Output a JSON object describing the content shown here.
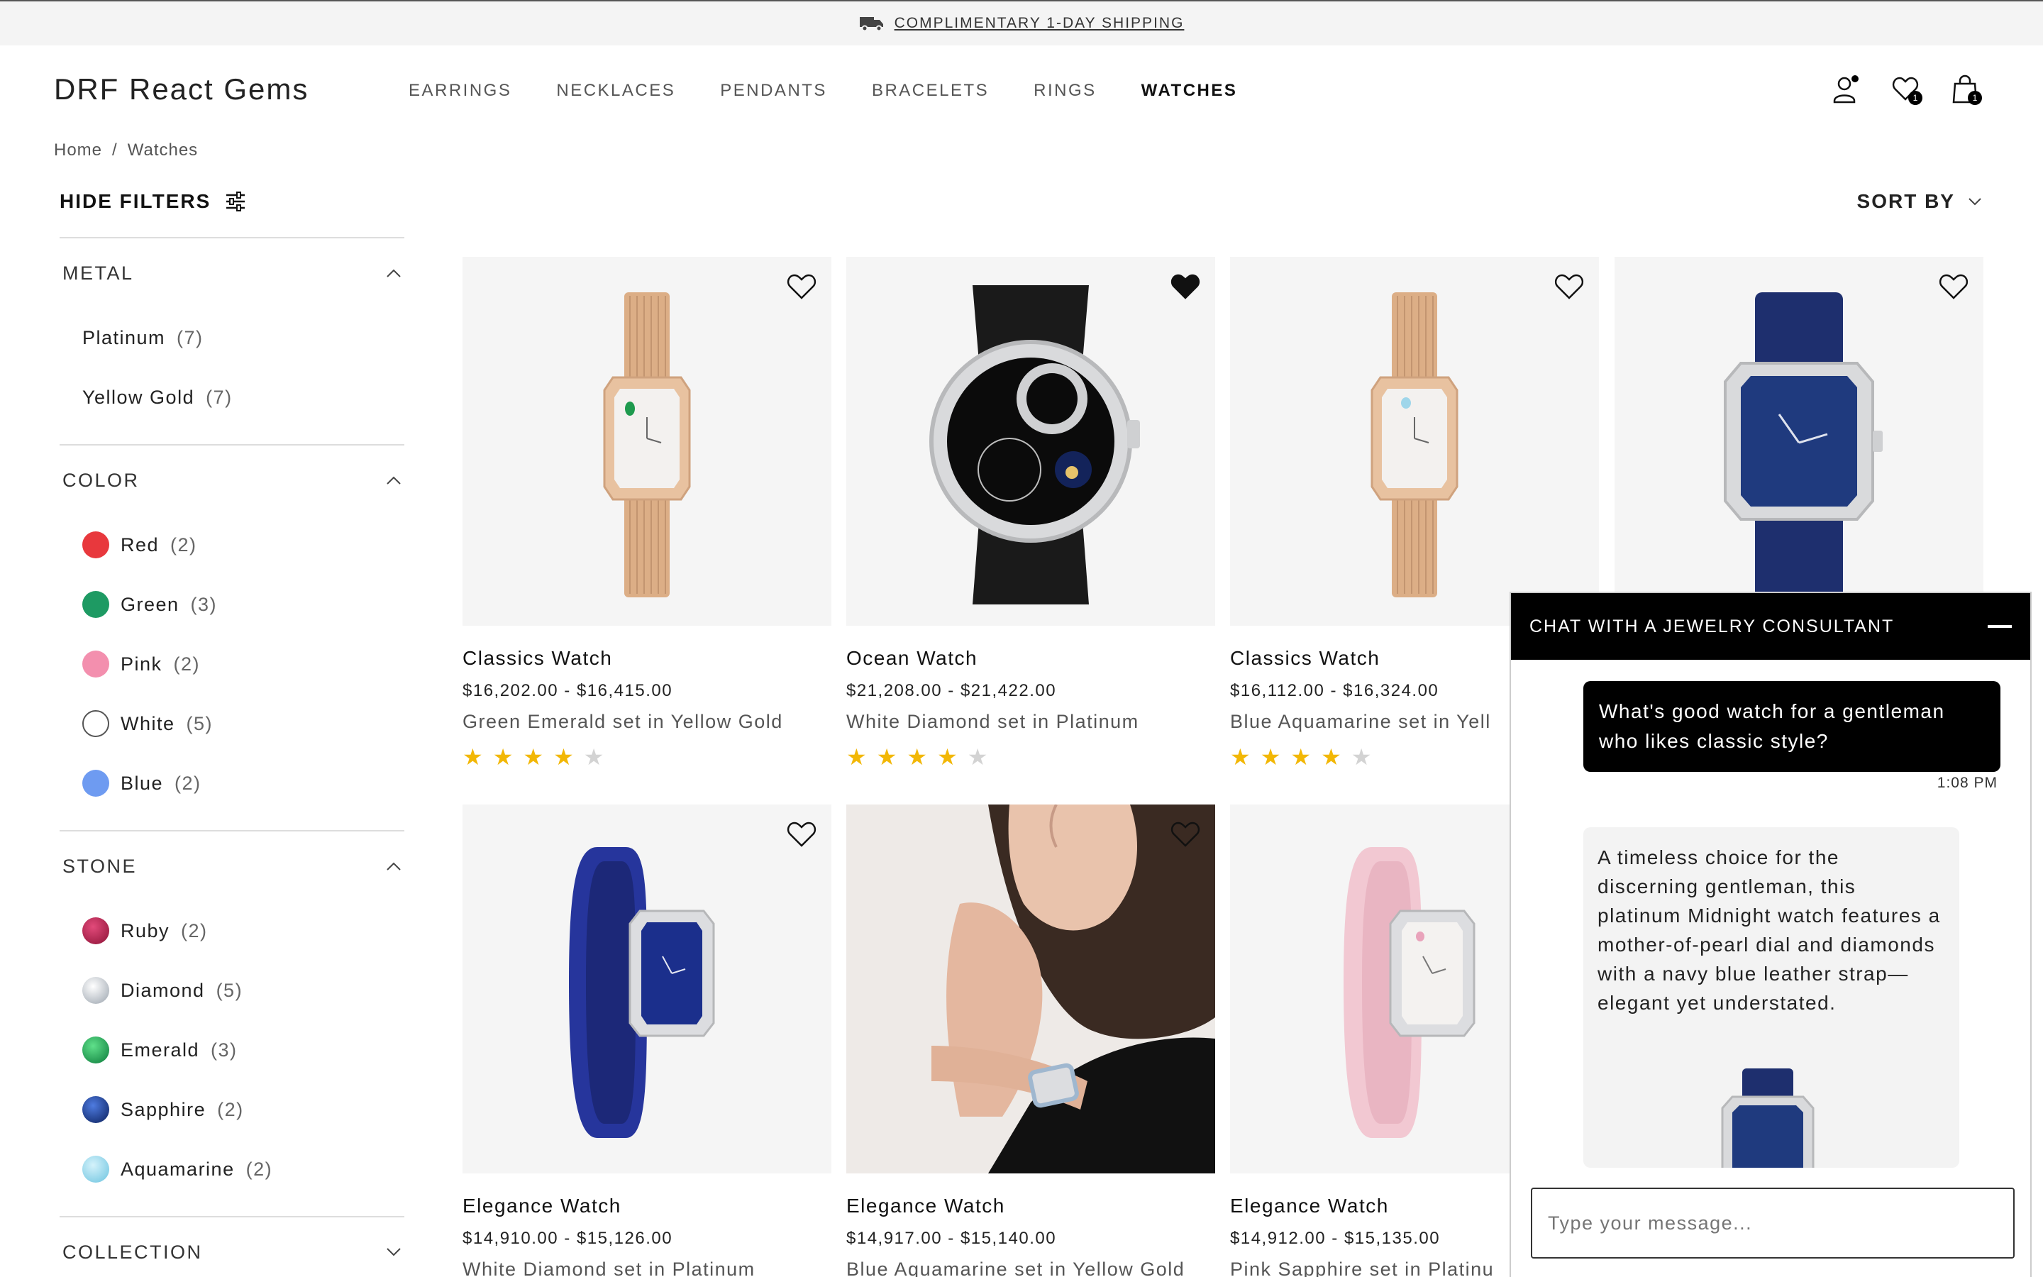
{
  "banner": {
    "text": "COMPLIMENTARY 1-DAY SHIPPING",
    "icon": "truck-icon"
  },
  "header": {
    "logo": "DRF React Gems",
    "nav": [
      "EARRINGS",
      "NECKLACES",
      "PENDANTS",
      "BRACELETS",
      "RINGS",
      "WATCHES"
    ],
    "active_nav": "WATCHES",
    "icons": {
      "account": "user-icon",
      "wishlist": "heart-icon",
      "bag": "shopping-bag-icon"
    },
    "wishlist_count": "1",
    "bag_count": "1"
  },
  "breadcrumb": {
    "home": "Home",
    "sep": "/",
    "current": "Watches"
  },
  "filters": {
    "hide_label": "HIDE FILTERS",
    "sections": [
      {
        "title": "METAL",
        "options": [
          {
            "label": "Platinum",
            "count": "(7)"
          },
          {
            "label": "Yellow Gold",
            "count": "(7)"
          }
        ]
      },
      {
        "title": "COLOR",
        "options": [
          {
            "label": "Red",
            "count": "(2)",
            "color": "#e8383d"
          },
          {
            "label": "Green",
            "count": "(3)",
            "color": "#1e9a63"
          },
          {
            "label": "Pink",
            "count": "(2)",
            "color": "#f38fae"
          },
          {
            "label": "White",
            "count": "(5)",
            "color": "#ffffff"
          },
          {
            "label": "Blue",
            "count": "(2)",
            "color": "#6e9bf1"
          }
        ]
      },
      {
        "title": "STONE",
        "options": [
          {
            "label": "Ruby",
            "count": "(2)",
            "color": "#b0244d"
          },
          {
            "label": "Diamond",
            "count": "(5)",
            "color": "#d8dde3"
          },
          {
            "label": "Emerald",
            "count": "(3)",
            "color": "#1fa453"
          },
          {
            "label": "Sapphire",
            "count": "(2)",
            "color": "#123a8a"
          },
          {
            "label": "Aquamarine",
            "count": "(2)",
            "color": "#8fd4ea"
          }
        ]
      },
      {
        "title": "COLLECTION",
        "options": []
      }
    ]
  },
  "sort": {
    "label": "SORT BY"
  },
  "products": [
    {
      "name": "Classics Watch",
      "price": "$16,202.00 - $16,415.00",
      "desc": "Green Emerald set in Yellow Gold",
      "rating": 4,
      "favorited": false
    },
    {
      "name": "Ocean Watch",
      "price": "$21,208.00 - $21,422.00",
      "desc": "White Diamond set in Platinum",
      "rating": 4,
      "favorited": true
    },
    {
      "name": "Classics Watch",
      "price": "$16,112.00 - $16,324.00",
      "desc": "Blue Aquamarine set in Yell",
      "rating": 4,
      "favorited": false
    },
    {
      "name": "",
      "price": "",
      "desc": "",
      "rating": 0,
      "favorited": false
    },
    {
      "name": "Elegance Watch",
      "price": "$14,910.00 - $15,126.00",
      "desc": "White Diamond set in Platinum",
      "rating": 0,
      "favorited": false
    },
    {
      "name": "Elegance Watch",
      "price": "$14,917.00 - $15,140.00",
      "desc": "Blue Aquamarine set in Yellow Gold",
      "rating": 0,
      "favorited": false
    },
    {
      "name": "Elegance Watch",
      "price": "$14,912.00 - $15,135.00",
      "desc": "Pink Sapphire set in Platinu",
      "rating": 0,
      "favorited": false
    }
  ],
  "chat": {
    "title": "CHAT WITH A JEWELRY CONSULTANT",
    "user_message": "What's good watch for a gentleman who likes classic style?",
    "time": "1:08 PM",
    "bot_message": "A timeless choice for the discerning gentleman, this platinum Midnight watch features a mother-of-pearl dial and diamonds with a navy blue leather strap—elegant yet understated.",
    "input_placeholder": "Type your message..."
  },
  "colors": {
    "star": "#f2b705",
    "star_off": "#d3d3d3",
    "chat_header": "#000000"
  }
}
